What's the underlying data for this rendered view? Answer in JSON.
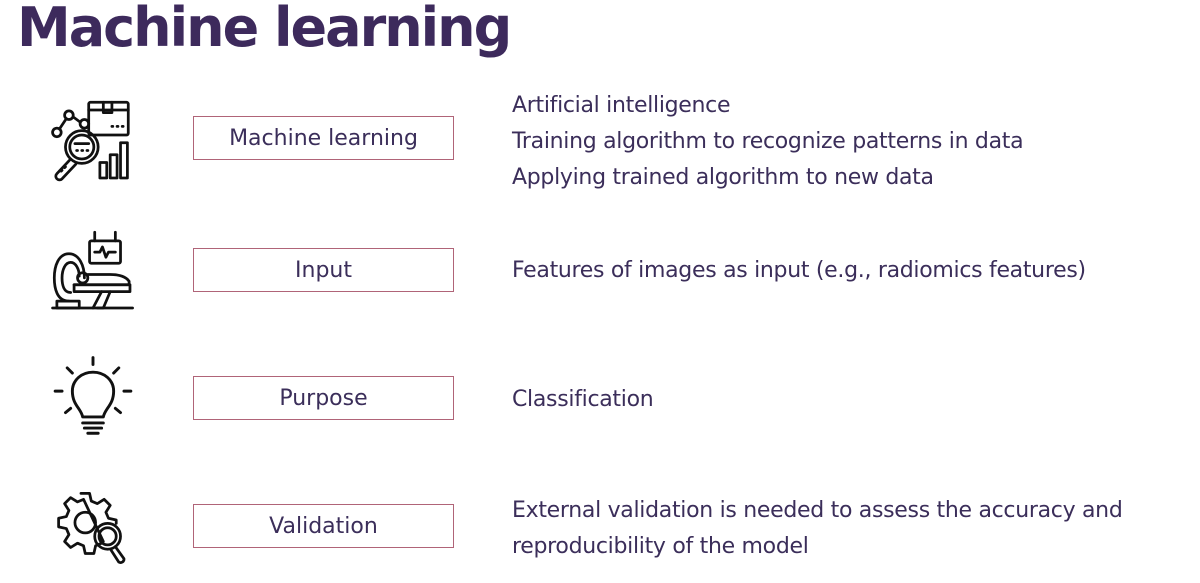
{
  "slide": {
    "title": "Machine learning",
    "colors": {
      "title": "#3d2a5c",
      "text": "#3b2e5a",
      "box_border": "#b06478"
    },
    "rows": [
      {
        "icon": "data-analysis-magnifier-chart-icon",
        "label": "Machine learning",
        "description": [
          "Artificial intelligence",
          "Training algorithm to recognize patterns in data",
          "Applying trained algorithm to new data"
        ]
      },
      {
        "icon": "ct-scanner-monitor-icon",
        "label": "Input",
        "description": [
          "Features of images as input (e.g., radiomics features)"
        ]
      },
      {
        "icon": "lightbulb-icon",
        "label": "Purpose",
        "description": [
          "Classification"
        ]
      },
      {
        "icon": "gear-magnifier-icon",
        "label": "Validation",
        "description": [
          "External validation is needed to assess the accuracy and",
          "reproducibility of the model"
        ]
      }
    ]
  }
}
